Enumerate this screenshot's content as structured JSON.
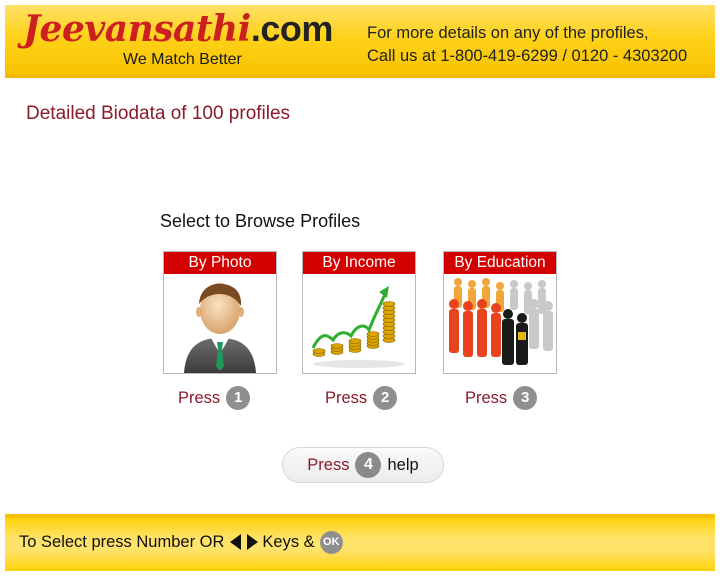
{
  "header": {
    "logo_main": "Jeevansathi",
    "logo_suffix": ".com",
    "tagline": "We Match Better",
    "contact_line1": "For more details on any of the profiles,",
    "contact_line2": "Call us at 1-800-419-6299 / 0120 - 4303200"
  },
  "main": {
    "title": "Detailed Biodata of 100 profiles",
    "browse_label": "Select to Browse Profiles",
    "cards": [
      {
        "label": "By Photo",
        "press": "Press",
        "number": "1",
        "icon": "person-avatar-icon"
      },
      {
        "label": "By Income",
        "press": "Press",
        "number": "2",
        "icon": "coins-growth-icon"
      },
      {
        "label": "By Education",
        "press": "Press",
        "number": "3",
        "icon": "crowd-people-icon"
      }
    ],
    "help": {
      "press": "Press",
      "number": "4",
      "label": "help"
    }
  },
  "footer": {
    "text_before": "To Select press Number OR",
    "text_after": "Keys &",
    "ok_label": "OK"
  },
  "colors": {
    "accent_red": "#d40000",
    "title_maroon": "#8b1a2b",
    "header_yellow": "#ffd21a"
  }
}
